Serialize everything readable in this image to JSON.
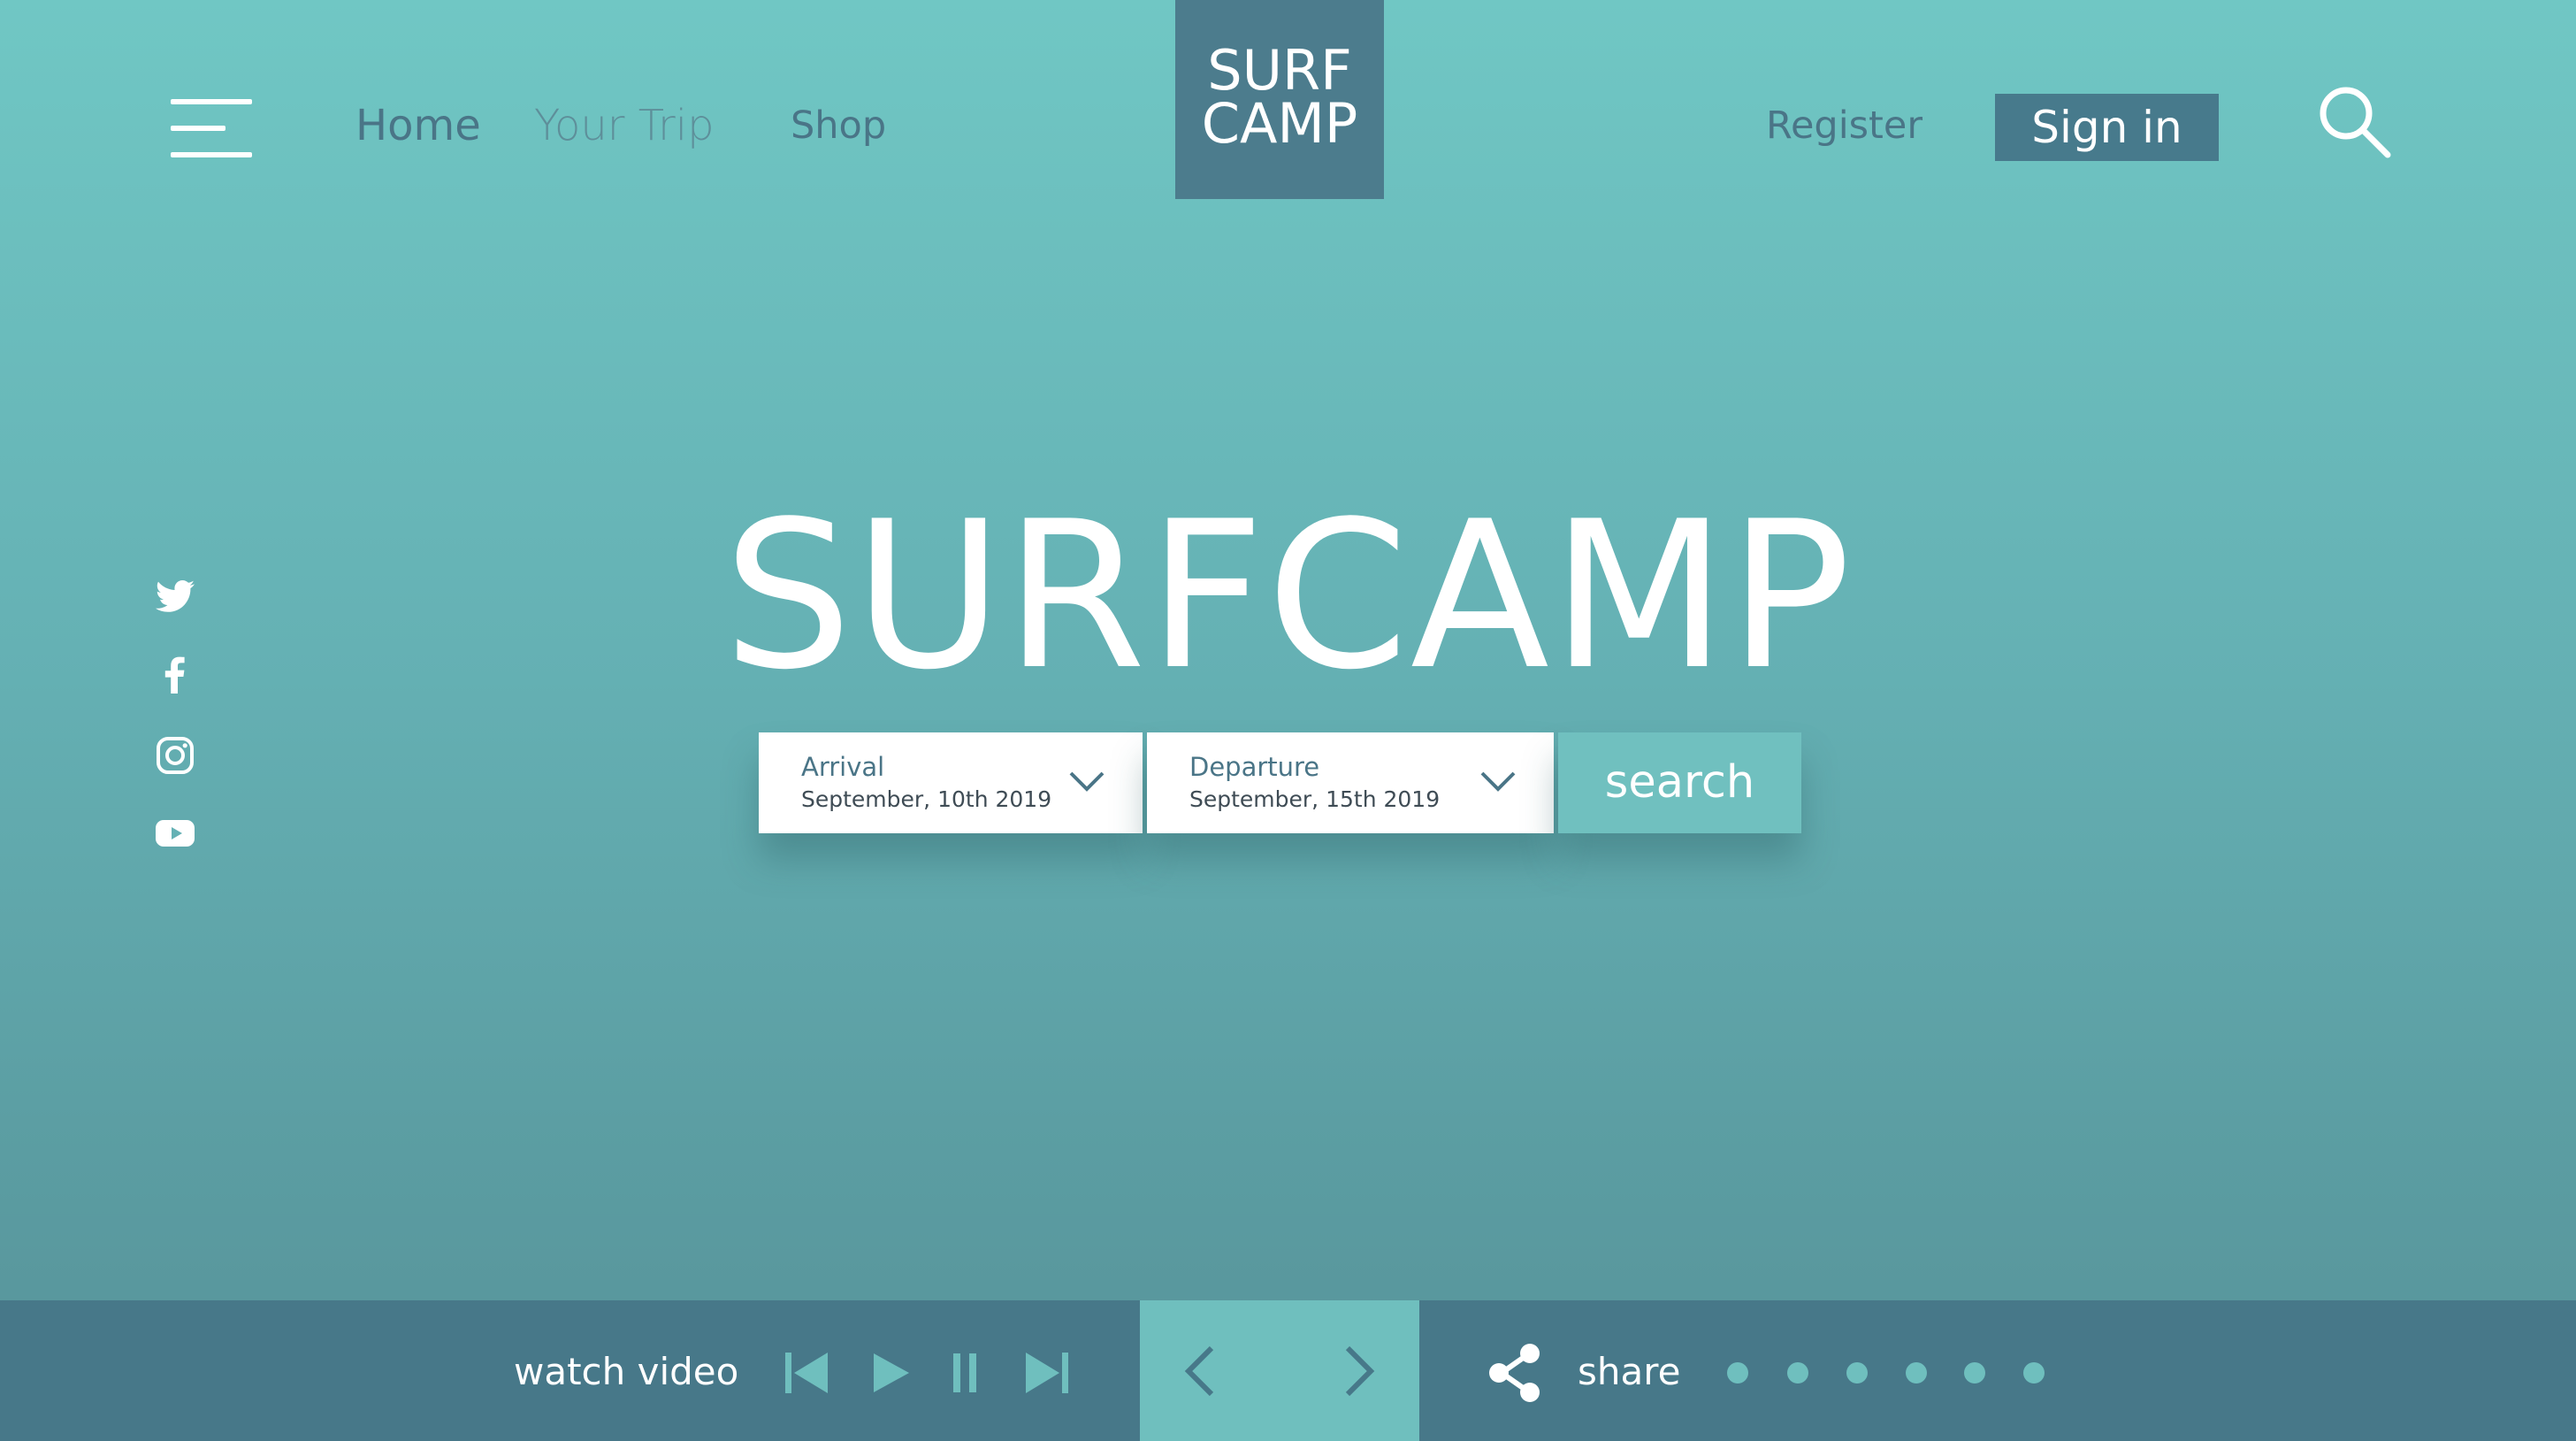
{
  "header": {
    "nav": {
      "home": "Home",
      "your_trip": "Your Trip",
      "shop": "Shop"
    },
    "logo": {
      "line1": "SURF",
      "line2": "CAMP"
    },
    "register": "Register",
    "sign_in": "Sign in"
  },
  "social_icons": [
    "twitter-icon",
    "facebook-icon",
    "instagram-icon",
    "youtube-icon"
  ],
  "hero": {
    "title": "SURFCAMP",
    "arrival": {
      "label": "Arrival",
      "value": "September, 10th 2019"
    },
    "departure": {
      "label": "Departure",
      "value": "September, 15th 2019"
    },
    "search_label": "search"
  },
  "footer": {
    "watch_video": "watch video",
    "media_controls": [
      "skip-back-icon",
      "play-icon",
      "pause-icon",
      "skip-forward-icon"
    ],
    "share": "share",
    "pagination_dots": 6
  },
  "colors": {
    "background_top": "#70c7c4",
    "background_bottom": "#579299",
    "dark_teal": "#477889",
    "light_teal": "#6fbfbe",
    "nav_text": "#4a7587"
  }
}
